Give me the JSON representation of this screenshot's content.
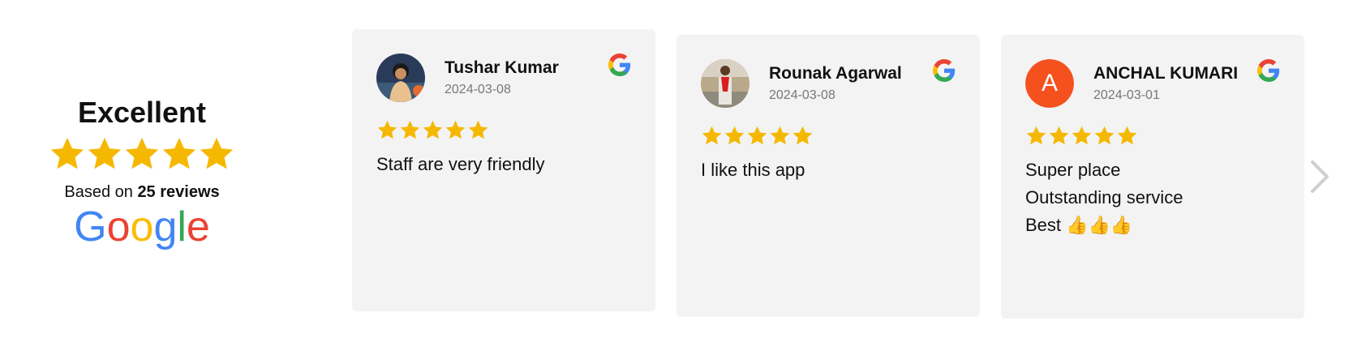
{
  "summary": {
    "rating_word": "Excellent",
    "rating": 5,
    "based_prefix": "Based on ",
    "review_count_text": "25 reviews",
    "brand_logo": "google-logo"
  },
  "colors": {
    "star": "#f5b800",
    "card_bg": "#f3f3f3",
    "avatar_anchal": "#f4511e",
    "arrow": "#cfcfcf",
    "date": "#777777"
  },
  "reviews": [
    {
      "name": "Tushar Kumar",
      "date": "2024-03-08",
      "rating": 5,
      "lines": [
        "Staff are very friendly"
      ],
      "avatar": "photo"
    },
    {
      "name": "Rounak Agarwal",
      "date": "2024-03-08",
      "rating": 5,
      "lines": [
        "I like this app"
      ],
      "avatar": "photo"
    },
    {
      "name": "ANCHAL KUMARI",
      "date": "2024-03-01",
      "rating": 5,
      "avatar_letter": "A",
      "lines": [
        "Super place",
        "Outstanding service",
        "Best 👍👍👍"
      ],
      "avatar": "letter"
    }
  ],
  "navigation": {
    "next_icon": "chevron-right-icon"
  }
}
